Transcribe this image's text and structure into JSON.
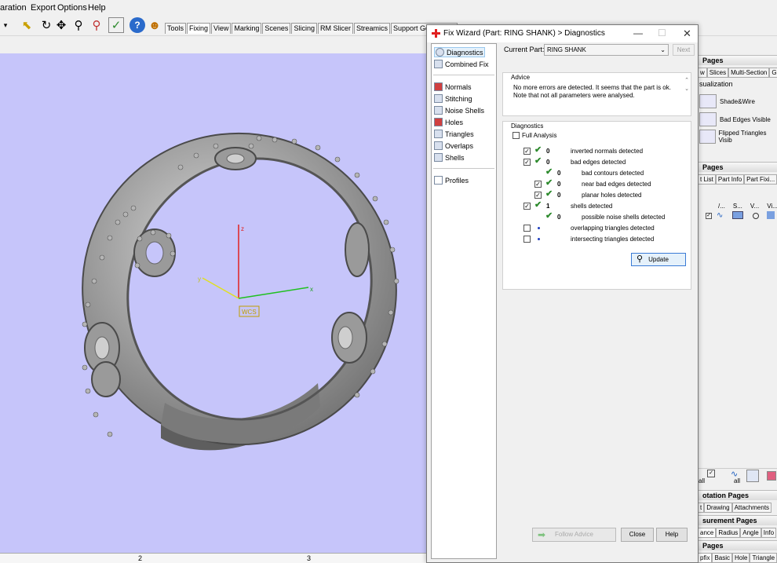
{
  "menu": {
    "items": [
      "aration",
      "Export",
      "Options",
      "Help"
    ]
  },
  "toolbar": {
    "tabs": [
      "Tools",
      "Fixing",
      "View",
      "Marking",
      "Scenes",
      "Slicing",
      "RM Slicer",
      "Streamics",
      "Support Generation"
    ],
    "selected_tab": "Fixing"
  },
  "viewport": {
    "background": "#c6c5fa",
    "axis_labels": {
      "z": "z",
      "x": "x",
      "y": "y"
    },
    "wcs_label": "WCS",
    "ruler_labels": [
      "2",
      "3"
    ]
  },
  "dialog": {
    "title": "Fix Wizard (Part: RING SHANK) > Diagnostics",
    "nav_top": [
      "Diagnostics",
      "Combined Fix"
    ],
    "nav_tools": [
      "Normals",
      "Stitching",
      "Noise Shells",
      "Holes",
      "Triangles",
      "Overlaps",
      "Shells"
    ],
    "nav_bottom": [
      "Profiles"
    ],
    "current_part_label": "Current Part:",
    "current_part_value": "RING SHANK",
    "next_label": "Next",
    "advice": {
      "label": "Advice",
      "text": "No more errors are detected. It seems that the part is ok. Note that not all parameters were analysed."
    },
    "diagnostics": {
      "label": "Diagnostics",
      "full_analysis_label": "Full Analysis",
      "rows": [
        {
          "checked": true,
          "status": "ok",
          "count": "0",
          "label": "inverted normals detected",
          "indent": 0
        },
        {
          "checked": true,
          "status": "ok",
          "count": "0",
          "label": "bad edges detected",
          "indent": 0
        },
        {
          "checked": null,
          "status": "ok",
          "count": "0",
          "label": "bad contours detected",
          "indent": 1
        },
        {
          "checked": true,
          "status": "ok",
          "count": "0",
          "label": "near bad edges detected",
          "indent": 1
        },
        {
          "checked": true,
          "status": "ok",
          "count": "0",
          "label": "planar holes detected",
          "indent": 1
        },
        {
          "checked": true,
          "status": "ok",
          "count": "1",
          "label": "shells detected",
          "indent": 0
        },
        {
          "checked": null,
          "status": "ok",
          "count": "0",
          "label": "possible noise shells detected",
          "indent": 1
        },
        {
          "checked": false,
          "status": "none",
          "count": "",
          "label": "overlapping triangles detected",
          "indent": 0
        },
        {
          "checked": false,
          "status": "none",
          "count": "",
          "label": "intersecting triangles detected",
          "indent": 0
        }
      ],
      "update_label": "Update"
    },
    "buttons": {
      "follow_advice": "Follow Advice",
      "close": "Close",
      "help": "Help"
    }
  },
  "right_panel": {
    "header1": "Pages",
    "tabs1": [
      "w",
      "Slices",
      "Multi-Section",
      "Gr"
    ],
    "visualization_label": "sualization",
    "vis_items": [
      "Shade&Wire",
      "Bad Edges Visible",
      "Flipped Triangles Visib"
    ],
    "header2": "Pages",
    "tabs2": [
      "t List",
      "Part Info",
      "Part Fixi..."
    ],
    "list_cols": [
      "/...",
      "S...",
      "V...",
      "Vi..."
    ],
    "header3": "otation Pages",
    "tabs3": [
      "t",
      "Drawing",
      "Attachments"
    ],
    "header4": "surement Pages",
    "tabs4": [
      "ance",
      "Radius",
      "Angle",
      "Info"
    ],
    "header5": "Pages",
    "tabs5": [
      "pfix",
      "Basic",
      "Hole",
      "Triangle"
    ],
    "mini_labels": [
      "all",
      "all"
    ]
  }
}
